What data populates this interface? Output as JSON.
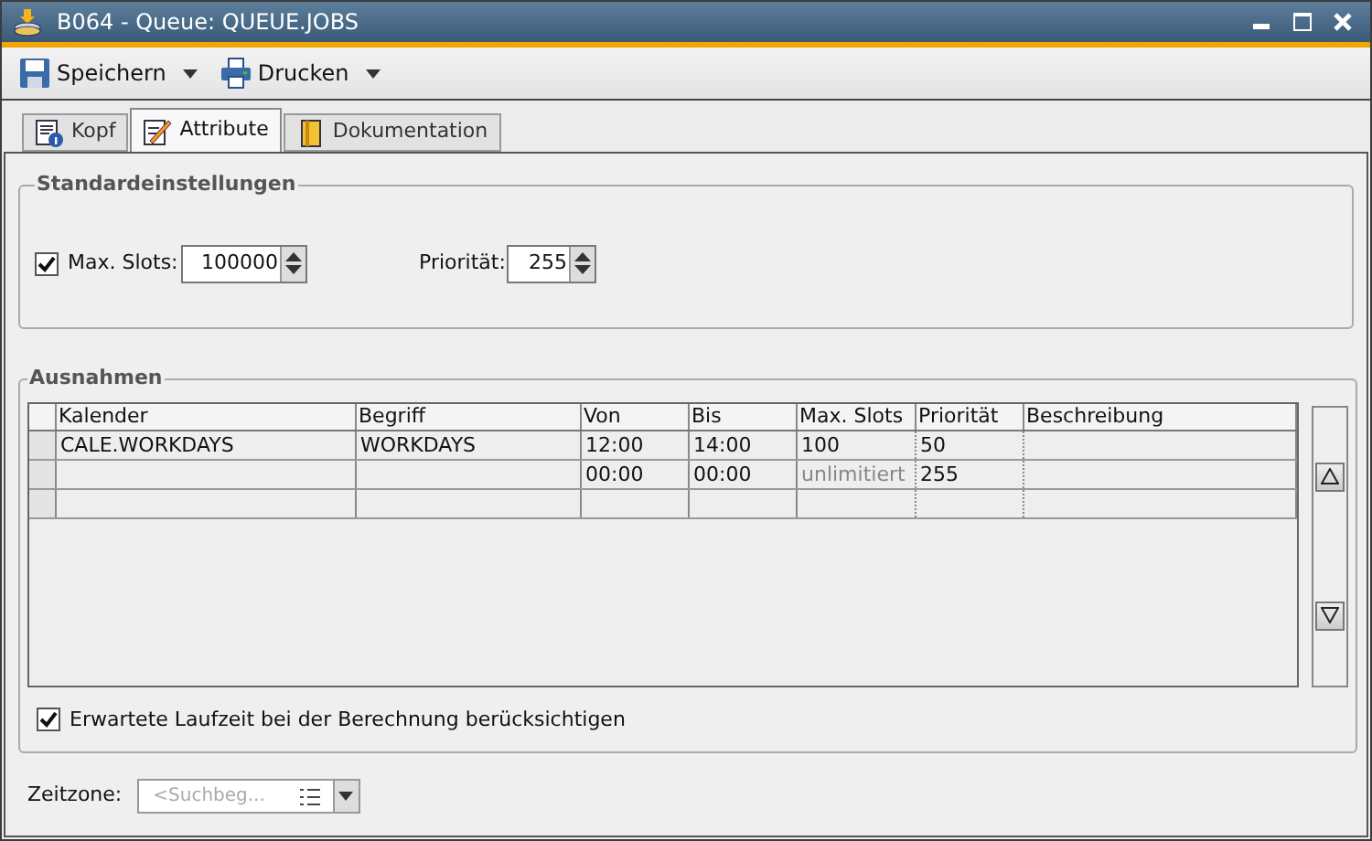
{
  "window": {
    "title": "B064 - Queue: QUEUE.JOBS"
  },
  "toolbar": [
    {
      "label": "Speichern",
      "kind": "save"
    },
    {
      "label": "Drucken",
      "kind": "print"
    }
  ],
  "tabs": [
    {
      "label": "Kopf",
      "kind": "info",
      "selected": false
    },
    {
      "label": "Attribute",
      "kind": "edit",
      "selected": true
    },
    {
      "label": "Dokumentation",
      "kind": "doc",
      "selected": false
    }
  ],
  "standard": {
    "title": "Standardeinstellungen",
    "max_slots_checked": true,
    "max_slots_label": "Max. Slots:",
    "max_slots_value": "100000",
    "priority_label": "Priorität:",
    "priority_value": "255"
  },
  "exceptions": {
    "title": "Ausnahmen",
    "columns": [
      "Kalender",
      "Begriff",
      "Von",
      "Bis",
      "Max. Slots",
      "Priorität",
      "Beschreibung"
    ],
    "rows": [
      {
        "cells": [
          "CALE.WORKDAYS",
          "WORKDAYS",
          "12:00",
          "14:00",
          "100",
          "50",
          null
        ],
        "max_slots_dimmed": false
      },
      {
        "cells": [
          null,
          null,
          "00:00",
          "00:00",
          "unlimitiert",
          "255",
          null
        ],
        "max_slots_dimmed": true
      },
      {
        "cells": [
          null,
          null,
          null,
          null,
          null,
          null,
          null
        ]
      }
    ],
    "runtime_checked": true,
    "runtime_label": "Erwartete Laufzeit bei der Berechnung berücksichtigen"
  },
  "timezone": {
    "label": "Zeitzone:",
    "placeholder": "<Suchbeg..."
  }
}
